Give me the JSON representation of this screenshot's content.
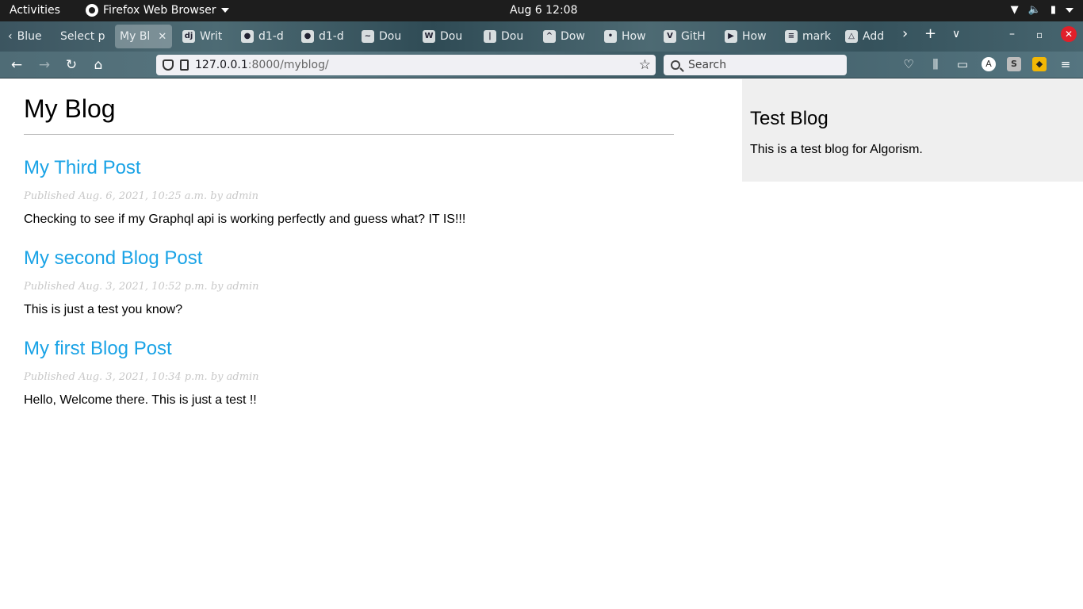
{
  "system": {
    "activities": "Activities",
    "app_name": "Firefox Web Browser",
    "clock": "Aug 6  12:08"
  },
  "tabs": [
    {
      "label": "Blue",
      "icon": "arrow-left-icon"
    },
    {
      "label": "Select p",
      "icon": ""
    },
    {
      "label": "My Bl",
      "icon": "",
      "active": true
    },
    {
      "label": "Writ",
      "icon": "dj"
    },
    {
      "label": "d1-d",
      "icon": "github-icon"
    },
    {
      "label": "d1-d",
      "icon": "github-icon"
    },
    {
      "label": "Dou",
      "icon": "squiggle-icon"
    },
    {
      "label": "Dou",
      "icon": "wordpress-icon"
    },
    {
      "label": "Dou",
      "icon": "candle-icon"
    },
    {
      "label": "Dow",
      "icon": "graduation-icon"
    },
    {
      "label": "How",
      "icon": "dot-icon"
    },
    {
      "label": "GitH",
      "icon": "vk-icon"
    },
    {
      "label": "How",
      "icon": "play-icon"
    },
    {
      "label": "mark",
      "icon": "stackoverflow-icon"
    },
    {
      "label": "Add",
      "icon": "drive-icon"
    }
  ],
  "url": {
    "host": "127.0.0.1",
    "path": ":8000/myblog/"
  },
  "search": {
    "placeholder": "Search"
  },
  "toolbar_badges": {
    "account": "A",
    "ext1": "S",
    "ext2": "◆"
  },
  "page": {
    "blog_title": "My Blog",
    "posts": [
      {
        "title": "My Third Post",
        "meta": "Published Aug. 6, 2021, 10:25 a.m. by admin",
        "body": "Checking to see if my Graphql api is working perfectly and guess what? IT IS!!!"
      },
      {
        "title": "My second Blog Post",
        "meta": "Published Aug. 3, 2021, 10:52 p.m. by admin",
        "body": "This is just a test you know?"
      },
      {
        "title": "My first Blog Post",
        "meta": "Published Aug. 3, 2021, 10:34 p.m. by admin",
        "body": "Hello, Welcome there. This is just a test !!"
      }
    ],
    "sidebar": {
      "title": "Test Blog",
      "text": "This is a test blog for Algorism."
    }
  },
  "colors": {
    "link": "#1aa3e6",
    "meta": "#c8c8c8",
    "sidebar_bg": "#efefef"
  }
}
